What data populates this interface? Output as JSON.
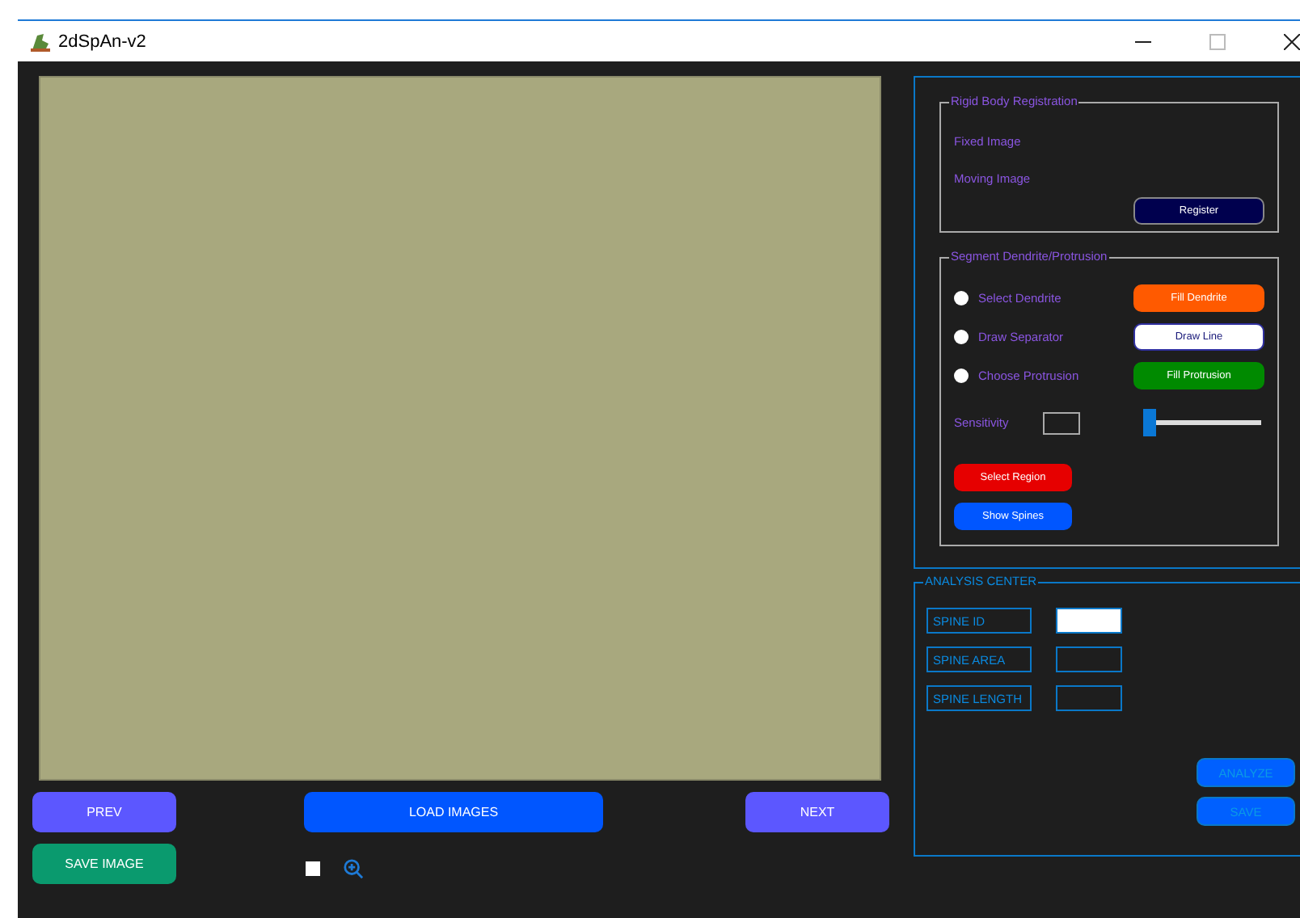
{
  "window": {
    "title": "2dSpAn-v2"
  },
  "viewer": {
    "buttons": [
      {
        "label": "PREV",
        "kind": "nav"
      },
      {
        "label": "LOAD IMAGES",
        "kind": "load"
      },
      {
        "label": "NEXT",
        "kind": "nav"
      }
    ],
    "save_button": "SAVE IMAGE",
    "checkbox": {
      "checked": false
    }
  },
  "registration": {
    "title": "Rigid Body Registration",
    "labels": [
      "Fixed Image",
      "Moving Image"
    ],
    "button": "Register"
  },
  "segment": {
    "title": "Segment Dendrite/Protrusion",
    "options": [
      {
        "label": "Select Dendrite",
        "selected": false,
        "button": "Fill Dendrite",
        "kind": "orange"
      },
      {
        "label": "Draw Separator",
        "selected": false,
        "button": "Draw Line",
        "kind": "white"
      },
      {
        "label": "Choose Protrusion",
        "selected": false,
        "button": "Fill Protrusion",
        "kind": "green"
      }
    ],
    "sensitivity": {
      "label": "Sensitivity",
      "level": 0.0
    },
    "buttons": [
      {
        "label": "Select Region",
        "kind": "red"
      },
      {
        "label": "Show Spines",
        "kind": "blue"
      }
    ]
  },
  "analysis": {
    "title": "ANALYSIS CENTER",
    "rows": [
      {
        "label": "SPINE ID",
        "focused": true
      },
      {
        "label": "SPINE AREA",
        "focused": false
      },
      {
        "label": "SPINE LENGTH",
        "focused": false
      }
    ],
    "buttons": [
      "ANALYZE",
      "SAVE"
    ]
  }
}
